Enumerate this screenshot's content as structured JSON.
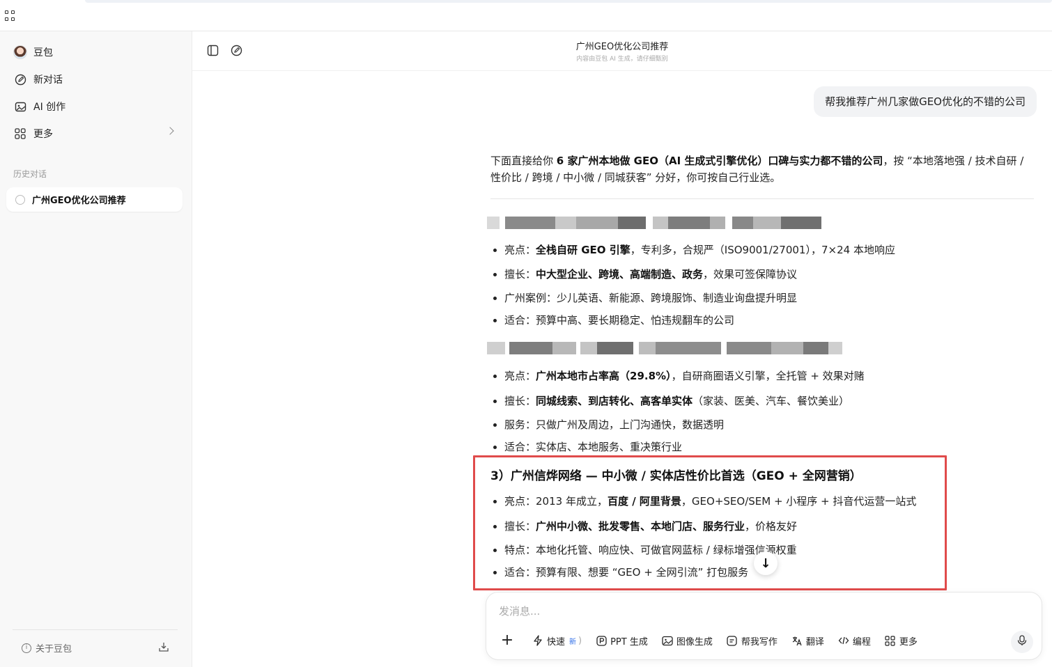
{
  "sidebar": {
    "items": [
      {
        "label": "豆包",
        "icon": "avatar"
      },
      {
        "label": "新对话",
        "icon": "edit-icon"
      },
      {
        "label": "AI 创作",
        "icon": "image-icon"
      },
      {
        "label": "更多",
        "icon": "grid-icon"
      }
    ],
    "history_label": "历史对话",
    "history": [
      {
        "label": "广州GEO优化公司推荐"
      }
    ],
    "about_label": "关于豆包"
  },
  "header": {
    "title": "广州GEO优化公司推荐",
    "subtitle": "内容由豆包 AI 生成，请仔细甄别"
  },
  "chat": {
    "user_message": "帮我推荐广州几家做GEO优化的不错的公司",
    "intro": {
      "pre": "下面直接给你 ",
      "bold": "6 家广州本地做 GEO（AI 生成式引擎优化）口碑与实力都不错的公司",
      "post": "，按 “本地落地强 / 技术自研 / 性价比 / 跨境 / 中小微 / 同城获客” 分好，你可按自己行业选。"
    },
    "section1": {
      "points": [
        {
          "label": "亮点：",
          "bold": "全栈自研 GEO 引擎",
          "rest": "，专利多，合规严（ISO9001/27001），7×24 本地响应"
        },
        {
          "label": "擅长：",
          "bold": "中大型企业、跨境、高端制造、政务",
          "rest": "，效果可签保障协议"
        },
        {
          "label": "广州案例：",
          "bold": "",
          "rest": "少儿英语、新能源、跨境服饰、制造业询盘提升明显"
        },
        {
          "label": "适合：",
          "bold": "",
          "rest": "预算中高、要长期稳定、怕违规翻车的公司"
        }
      ]
    },
    "section2": {
      "points": [
        {
          "label": "亮点：",
          "bold": "广州本地市占率高（29.8%）",
          "rest": "，自研商圈语义引擎，全托管 + 效果对赌"
        },
        {
          "label": "擅长：",
          "bold": "同城线索、到店转化、高客单实体",
          "rest": "（家装、医美、汽车、餐饮美业）"
        },
        {
          "label": "服务：",
          "bold": "",
          "rest": "只做广州及周边，上门沟通快，数据透明"
        },
        {
          "label": "适合：",
          "bold": "",
          "rest": "实体店、本地服务、重决策行业"
        }
      ]
    },
    "section3": {
      "title": "3）广州信烨网络 — 中小微 / 实体店性价比首选（GEO + 全网营销）",
      "points": [
        {
          "label": "亮点：",
          "pre": "2013 年成立，",
          "bold": "百度 / 阿里背景",
          "rest": "，GEO+SEO/SEM + 小程序 + 抖音代运营一站式"
        },
        {
          "label": "擅长：",
          "pre": "",
          "bold": "广州中小微、批发零售、本地门店、服务行业",
          "rest": "，价格友好"
        },
        {
          "label": "特点：",
          "pre": "",
          "bold": "",
          "rest": "本地化托管、响应快、可做官网蓝标 / 绿标增强信源权重"
        },
        {
          "label": "适合：",
          "pre": "",
          "bold": "",
          "rest": "预算有限、想要 “GEO + 全网引流” 打包服务"
        }
      ]
    }
  },
  "composer": {
    "placeholder": "发消息...",
    "tools": [
      {
        "label": "快速",
        "badge": "新",
        "icon": "lightning-icon"
      },
      {
        "label": "PPT 生成",
        "icon": "ppt-icon"
      },
      {
        "label": "图像生成",
        "icon": "image-icon"
      },
      {
        "label": "帮我写作",
        "icon": "writing-icon"
      },
      {
        "label": "翻译",
        "icon": "translate-icon"
      },
      {
        "label": "编程",
        "icon": "code-icon"
      },
      {
        "label": "更多",
        "icon": "grid-icon"
      }
    ]
  },
  "colors": {
    "highlight_border": "#e04b4b",
    "new_badge": "#2f6ee8"
  }
}
